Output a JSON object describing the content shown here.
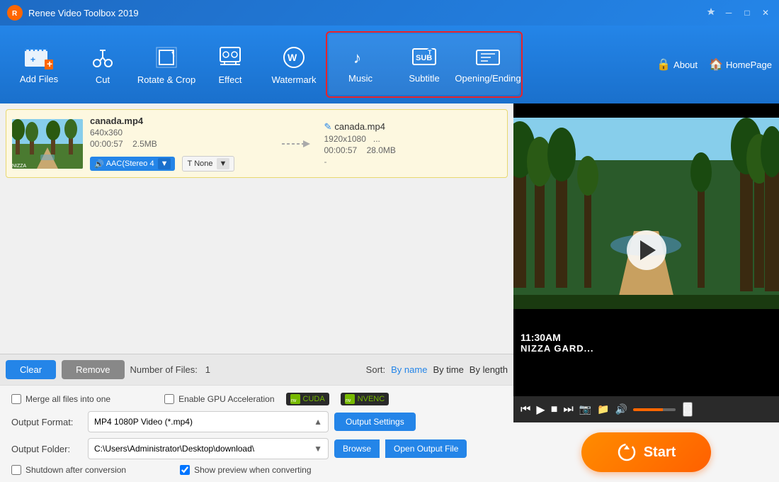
{
  "app": {
    "title": "Renee Video Toolbox 2019",
    "logo": "R"
  },
  "titlebar": {
    "minimize": "─",
    "maximize": "□",
    "close": "✕"
  },
  "toolbar": {
    "items": [
      {
        "id": "add-files",
        "label": "Add Files",
        "icon": "🎬"
      },
      {
        "id": "cut",
        "label": "Cut",
        "icon": "✂"
      },
      {
        "id": "rotate-crop",
        "label": "Rotate & Crop",
        "icon": "⟳"
      },
      {
        "id": "effect",
        "label": "Effect",
        "icon": "🎨"
      },
      {
        "id": "watermark",
        "label": "Watermark",
        "icon": "🎭"
      },
      {
        "id": "music",
        "label": "Music",
        "icon": "♪"
      },
      {
        "id": "subtitle",
        "label": "Subtitle",
        "icon": "SUB"
      },
      {
        "id": "opening-ending",
        "label": "Opening/Ending",
        "icon": "▤"
      }
    ],
    "about": "About",
    "homepage": "HomePage"
  },
  "file": {
    "input": {
      "name": "canada.mp4",
      "resolution": "640x360",
      "duration": "00:00:57",
      "size": "2.5MB",
      "audio": "AAC(Stereo 4",
      "font": "None"
    },
    "output": {
      "name": "canada.mp4",
      "resolution": "1920x1080",
      "duration": "00:00:57",
      "size": "28.0MB",
      "extra": "-"
    }
  },
  "bottom_toolbar": {
    "clear": "Clear",
    "remove": "Remove",
    "file_count_label": "Number of Files:",
    "file_count": "1",
    "sort_label": "Sort:",
    "sort_by_name": "By name",
    "sort_by_time": "By time",
    "sort_by_length": "By length"
  },
  "settings": {
    "merge_label": "Merge all files into one",
    "gpu_label": "Enable GPU Acceleration",
    "cuda_label": "CUDA",
    "nvenc_label": "NVENC",
    "output_format_label": "Output Format:",
    "output_format_value": "MP4 1080P Video (*.mp4)",
    "output_settings_btn": "Output Settings",
    "output_folder_label": "Output Folder:",
    "output_folder_value": "C:\\Users\\Administrator\\Desktop\\download\\",
    "browse_btn": "Browse",
    "open_output_btn": "Open Output File",
    "shutdown_label": "Shutdown after conversion",
    "show_preview_label": "Show preview when converting"
  },
  "video": {
    "overlay_time": "11:30AM",
    "overlay_place": "NIZZA GARD..."
  },
  "start_btn": "Start"
}
